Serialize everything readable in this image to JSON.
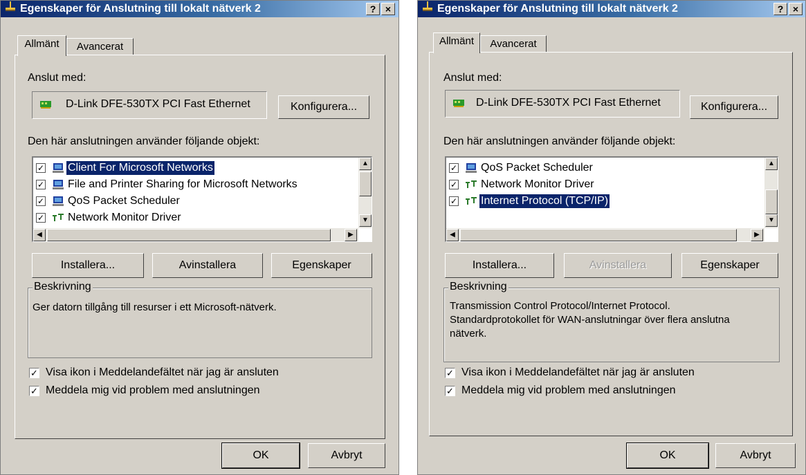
{
  "dialogs": [
    {
      "title": "Egenskaper för Anslutning till lokalt nätverk 2",
      "help_btn": "?",
      "close_btn": "×",
      "tabs": [
        {
          "label": "Allmänt"
        },
        {
          "label": "Avancerat"
        }
      ],
      "connect_label": "Anslut med:",
      "adapter_name": "D-Link DFE-530TX PCI Fast Ethernet",
      "configure_btn": "Konfigurera...",
      "items_label": "Den här anslutningen använder följande objekt:",
      "items": [
        {
          "label": "Client For Microsoft Networks",
          "checked": true,
          "icon": "network-client-icon"
        },
        {
          "label": "File and Printer Sharing for Microsoft Networks",
          "checked": true,
          "icon": "file-sharing-icon"
        },
        {
          "label": "QoS Packet Scheduler",
          "checked": true,
          "icon": "qos-icon"
        },
        {
          "label": "Network Monitor Driver",
          "checked": true,
          "icon": "protocol-icon"
        }
      ],
      "install_btn": "Installera...",
      "uninstall_btn": "Avinstallera",
      "properties_btn": "Egenskaper",
      "description_label": "Beskrivning",
      "description_text": "Ger datorn tillgång till resurser i ett Microsoft-nätverk.",
      "show_icon_label": "Visa ikon i Meddelandefältet när jag är ansluten",
      "notify_label": "Meddela mig vid problem med anslutningen",
      "ok_btn": "OK",
      "cancel_btn": "Avbryt"
    },
    {
      "title": "Egenskaper för Anslutning till lokalt nätverk 2",
      "help_btn": "?",
      "close_btn": "×",
      "tabs": [
        {
          "label": "Allmänt"
        },
        {
          "label": "Avancerat"
        }
      ],
      "connect_label": "Anslut med:",
      "adapter_name": "D-Link DFE-530TX PCI Fast Ethernet",
      "configure_btn": "Konfigurera...",
      "items_label": "Den här anslutningen använder följande objekt:",
      "items": [
        {
          "label": "QoS Packet Scheduler",
          "checked": true,
          "icon": "qos-icon"
        },
        {
          "label": "Network Monitor Driver",
          "checked": true,
          "icon": "protocol-icon"
        },
        {
          "label": "Internet Protocol (TCP/IP)",
          "checked": true,
          "icon": "protocol-icon"
        }
      ],
      "install_btn": "Installera...",
      "uninstall_btn": "Avinstallera",
      "properties_btn": "Egenskaper",
      "description_label": "Beskrivning",
      "description_text": "Transmission Control Protocol/Internet Protocol.",
      "description_text2": "Standardprotokollet för WAN-anslutningar över flera anslutna",
      "description_text3": "nätverk.",
      "show_icon_label": "Visa ikon i Meddelandefältet när jag är ansluten",
      "notify_label": "Meddela mig vid problem med anslutningen",
      "ok_btn": "OK",
      "cancel_btn": "Avbryt"
    }
  ]
}
